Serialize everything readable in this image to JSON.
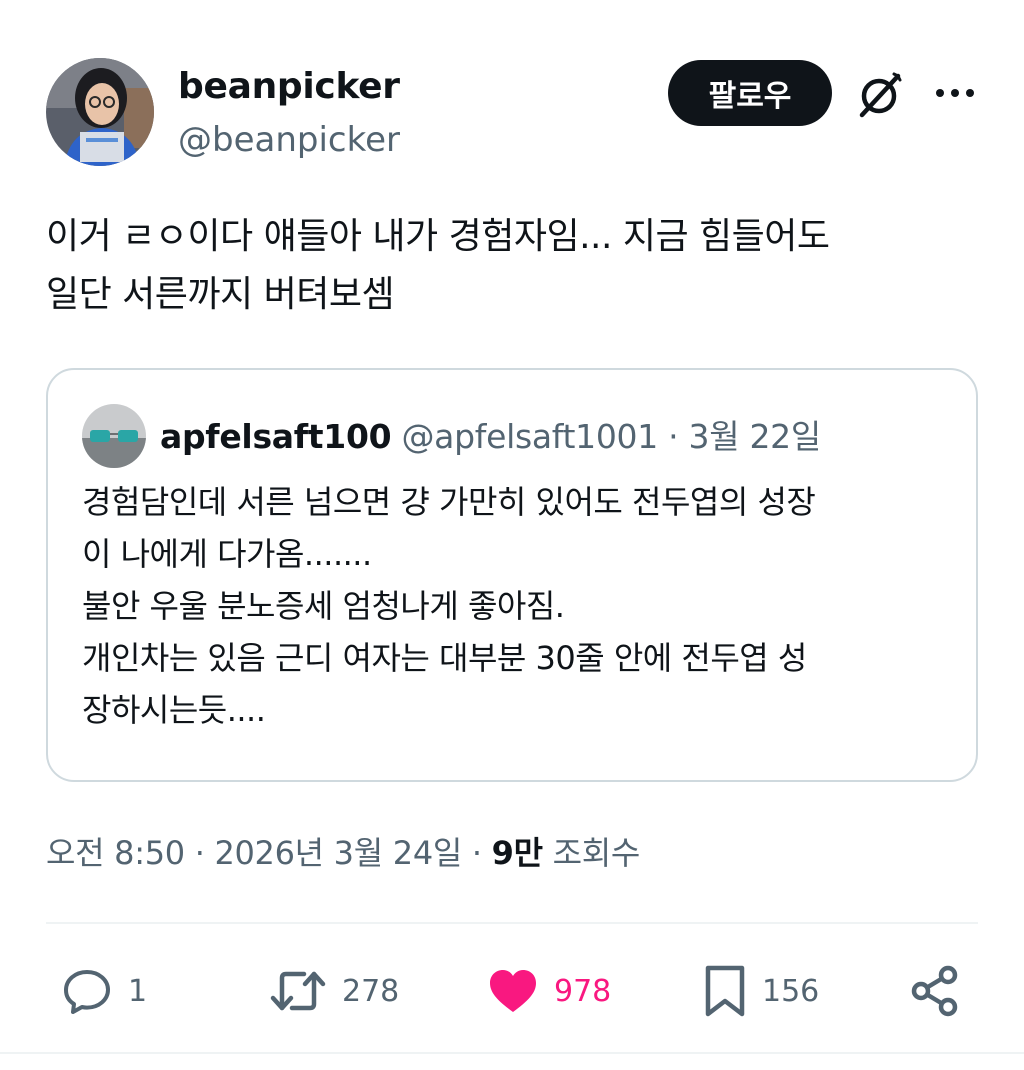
{
  "author": {
    "display_name": "beanpicker",
    "handle": "@beanpicker",
    "avatar_icon": "user-avatar"
  },
  "header": {
    "follow_label": "팔로우",
    "grok_icon": "grok-icon",
    "more_icon": "more-icon"
  },
  "tweet": {
    "lines": [
      "이거 ㄹㅇ이다 얘들아 내가 경험자임... 지금 힘들어도",
      "일단 서른까지 버텨보셈"
    ]
  },
  "quote": {
    "display_name": "apfelsaft100",
    "handle": "@apfelsaft1001",
    "separator": "·",
    "date": "3월 22일",
    "lines": [
      "경험담인데 서른 넘으면 걍 가만히 있어도 전두엽의 성장",
      "이 나에게 다가옴.......",
      "불안 우울 분노증세 엄청나게 좋아짐.",
      "개인차는 있음 근디 여자는 대부분 30줄 안에 전두엽 성",
      "장하시는듯...."
    ]
  },
  "meta": {
    "time": "오전 8:50",
    "separator": "·",
    "date": "2026년 3월 24일",
    "views_count": "9만",
    "views_label": "조회수"
  },
  "actions": {
    "reply_count": "1",
    "retweet_count": "278",
    "like_count": "978",
    "bookmark_count": "156",
    "like_color": "#f91880",
    "icon_color": "#536471"
  }
}
